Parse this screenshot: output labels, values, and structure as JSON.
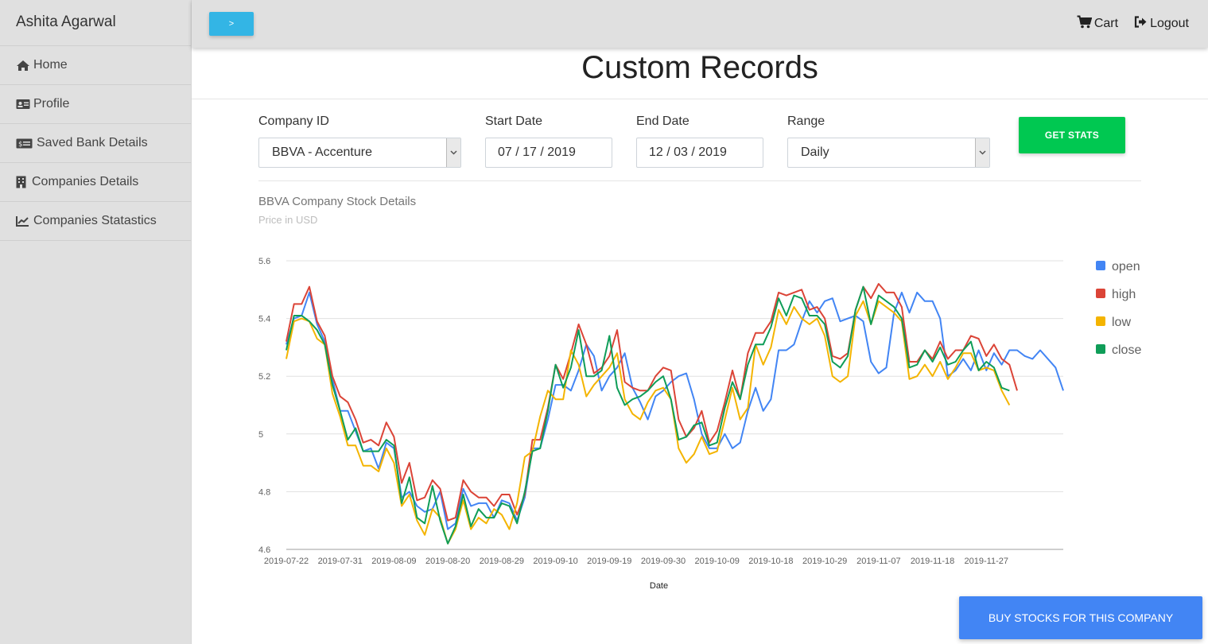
{
  "sidebar": {
    "user_name": "Ashita Agarwal",
    "items": [
      {
        "label": "Home",
        "icon": "home-icon"
      },
      {
        "label": "Profile",
        "icon": "id-card-icon"
      },
      {
        "label": "Saved Bank Details",
        "icon": "money-bill-icon"
      },
      {
        "label": "Companies Details",
        "icon": "building-icon"
      },
      {
        "label": "Companies Statastics",
        "icon": "line-chart-icon"
      }
    ]
  },
  "topbar": {
    "toggle_label": ">",
    "toggle_color": "#33b5e5",
    "cart_label": "Cart",
    "logout_label": "Logout"
  },
  "page": {
    "title": "Custom Records"
  },
  "form": {
    "company_label": "Company ID",
    "company_value": "BBVA - Accenture",
    "start_label": "Start Date",
    "start_value": "07 / 17 / 2019",
    "end_label": "End Date",
    "end_value": "12 / 03 / 2019",
    "range_label": "Range",
    "range_value": "Daily",
    "get_stats_label": "GET STATS",
    "get_stats_color": "#00c851"
  },
  "chart_data": {
    "type": "line",
    "title": "BBVA Company Stock Details",
    "subtitle": "Price in USD",
    "xlabel": "Date",
    "ylabel": "",
    "ylim": [
      4.6,
      5.6
    ],
    "y_ticks": [
      "4.6",
      "4.8",
      "5",
      "5.2",
      "5.4",
      "5.6"
    ],
    "x_ticks": [
      "2019-07-22",
      "2019-07-31",
      "2019-08-09",
      "2019-08-20",
      "2019-08-29",
      "2019-09-10",
      "2019-09-19",
      "2019-09-30",
      "2019-10-09",
      "2019-10-18",
      "2019-10-29",
      "2019-11-07",
      "2019-11-18",
      "2019-11-27"
    ],
    "grid": true,
    "legend_position": "right",
    "series": [
      {
        "name": "open",
        "color": "#4285f4",
        "values": [
          5.31,
          5.4,
          5.41,
          5.49,
          5.38,
          5.32,
          5.19,
          5.08,
          5.08,
          5.01,
          4.94,
          4.95,
          4.88,
          4.97,
          4.95,
          4.78,
          4.8,
          4.75,
          4.73,
          4.74,
          4.8,
          4.67,
          4.69,
          4.81,
          4.75,
          4.76,
          4.76,
          4.71,
          4.77,
          4.76,
          4.7,
          4.78,
          4.95,
          4.95,
          5.05,
          5.17,
          5.17,
          5.15,
          5.22,
          5.31,
          5.27,
          5.15,
          5.2,
          5.23,
          5.28,
          5.16,
          5.11,
          5.05,
          5.13,
          5.15,
          5.18,
          5.2,
          5.21,
          5.12,
          5.0,
          4.95,
          4.95,
          5.0,
          4.95,
          4.97,
          5.08,
          5.16,
          5.08,
          5.12,
          5.29,
          5.29,
          5.31,
          5.39,
          5.46,
          5.42,
          5.46,
          5.47,
          5.39,
          5.4,
          5.41,
          5.39,
          5.25,
          5.21,
          5.23,
          5.42,
          5.49,
          5.42,
          5.49,
          5.46,
          5.46,
          5.4,
          5.2,
          5.22,
          5.26,
          5.22,
          5.29,
          5.22,
          5.28,
          5.24,
          5.29,
          5.29,
          5.27,
          5.26,
          5.29,
          5.26,
          5.23,
          5.15
        ]
      },
      {
        "name": "high",
        "color": "#db4437",
        "values": [
          5.32,
          5.45,
          5.45,
          5.51,
          5.39,
          5.34,
          5.2,
          5.13,
          5.11,
          5.05,
          4.97,
          4.98,
          4.96,
          5.04,
          4.99,
          4.83,
          4.9,
          4.77,
          4.78,
          4.84,
          4.81,
          4.7,
          4.71,
          4.84,
          4.8,
          4.78,
          4.78,
          4.75,
          4.79,
          4.79,
          4.72,
          4.79,
          4.98,
          4.98,
          5.09,
          5.24,
          5.19,
          5.28,
          5.38,
          5.31,
          5.21,
          5.23,
          5.27,
          5.36,
          5.18,
          5.16,
          5.15,
          5.15,
          5.2,
          5.23,
          5.22,
          5.05,
          4.99,
          5.02,
          5.08,
          4.97,
          5.01,
          5.11,
          5.22,
          5.12,
          5.28,
          5.35,
          5.35,
          5.39,
          5.49,
          5.48,
          5.49,
          5.5,
          5.43,
          5.44,
          5.4,
          5.27,
          5.26,
          5.28,
          5.43,
          5.51,
          5.47,
          5.52,
          5.49,
          5.49,
          5.44,
          5.25,
          5.25,
          5.29,
          5.26,
          5.32,
          5.26,
          5.29,
          5.29,
          5.34,
          5.33,
          5.27,
          5.31,
          5.26,
          5.24,
          5.15
        ]
      },
      {
        "name": "low",
        "color": "#f4b400",
        "values": [
          5.26,
          5.39,
          5.4,
          5.39,
          5.33,
          5.31,
          5.14,
          5.06,
          4.96,
          4.96,
          4.89,
          4.89,
          4.87,
          4.95,
          4.9,
          4.75,
          4.79,
          4.7,
          4.65,
          4.74,
          4.71,
          4.62,
          4.67,
          4.77,
          4.67,
          4.71,
          4.69,
          4.74,
          4.72,
          4.67,
          4.76,
          4.92,
          4.94,
          5.06,
          5.15,
          5.12,
          5.12,
          5.29,
          5.24,
          5.13,
          5.17,
          5.2,
          5.23,
          5.28,
          5.12,
          5.07,
          5.05,
          5.11,
          5.15,
          5.16,
          5.12,
          4.95,
          4.9,
          4.93,
          4.99,
          4.93,
          4.94,
          5.05,
          5.16,
          5.05,
          5.09,
          5.31,
          5.24,
          5.3,
          5.43,
          5.38,
          5.44,
          5.4,
          5.38,
          5.4,
          5.34,
          5.2,
          5.18,
          5.2,
          5.41,
          5.46,
          5.38,
          5.46,
          5.44,
          5.42,
          5.39,
          5.19,
          5.2,
          5.24,
          5.2,
          5.25,
          5.19,
          5.23,
          5.28,
          5.28,
          5.22,
          5.23,
          5.22,
          5.15,
          5.1
        ]
      },
      {
        "name": "close",
        "color": "#0f9d58",
        "values": [
          5.29,
          5.41,
          5.41,
          5.39,
          5.36,
          5.31,
          5.17,
          5.08,
          4.98,
          5.02,
          4.94,
          4.94,
          4.94,
          4.98,
          4.96,
          4.76,
          4.85,
          4.71,
          4.69,
          4.82,
          4.7,
          4.62,
          4.68,
          4.79,
          4.68,
          4.74,
          4.71,
          4.71,
          4.76,
          4.75,
          4.69,
          4.8,
          4.94,
          4.95,
          5.08,
          5.24,
          5.16,
          5.23,
          5.36,
          5.2,
          5.2,
          5.22,
          5.34,
          5.16,
          5.1,
          5.12,
          5.13,
          5.15,
          5.18,
          5.2,
          5.12,
          4.98,
          4.99,
          5.03,
          5.04,
          4.96,
          4.97,
          5.09,
          5.18,
          5.12,
          5.24,
          5.31,
          5.31,
          5.37,
          5.47,
          5.41,
          5.48,
          5.47,
          5.41,
          5.41,
          5.38,
          5.25,
          5.23,
          5.27,
          5.43,
          5.51,
          5.38,
          5.48,
          5.46,
          5.44,
          5.4,
          5.23,
          5.24,
          5.29,
          5.25,
          5.3,
          5.24,
          5.25,
          5.29,
          5.32,
          5.22,
          5.25,
          5.23,
          5.16,
          5.15
        ]
      }
    ]
  },
  "footer": {
    "buy_label": "BUY STOCKS FOR THIS COMPANY",
    "buy_color": "#4285f4"
  }
}
